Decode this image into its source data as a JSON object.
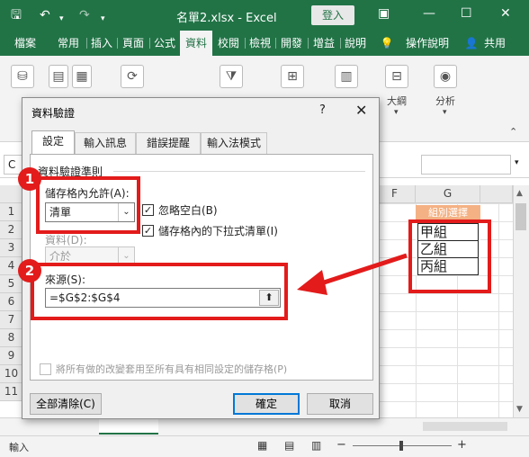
{
  "titlebar": {
    "file_title": "名單2.xlsx  -  Excel",
    "login_label": "登入",
    "minimize_glyph": "—",
    "maximize_glyph": "☐",
    "close_glyph": "✕"
  },
  "ribbon_tabs": [
    "檔案",
    "常用",
    "插入",
    "頁面",
    "公式",
    "資料",
    "校閱",
    "檢視",
    "開發",
    "增益",
    "說明"
  ],
  "ribbon_extra": {
    "tell_me": "操作說明",
    "share": "共用"
  },
  "ribbon_groups": {
    "outline": "大綱",
    "analysis": "分析"
  },
  "formula_bar": {
    "name_box": "C"
  },
  "sheet": {
    "columns": [
      "F",
      "G"
    ],
    "rows": [
      "1",
      "2",
      "3",
      "4",
      "5",
      "6",
      "7",
      "8",
      "9",
      "10",
      "11"
    ],
    "g_header_cell": "組別選擇",
    "g_cells": [
      "甲組",
      "乙組",
      "丙組"
    ]
  },
  "status": {
    "mode": "輸入"
  },
  "dialog": {
    "title": "資料驗證",
    "help_glyph": "?",
    "close_glyph": "✕",
    "tabs": [
      "設定",
      "輸入訊息",
      "錯誤提醒",
      "輸入法模式"
    ],
    "section_label": "資料驗證準則",
    "allow_label": "儲存格內允許(A):",
    "allow_value": "清單",
    "ignore_blank_label": "忽略空白(B)",
    "dropdown_label": "儲存格內的下拉式清單(I)",
    "data_label": "資料(D):",
    "data_value": "介於",
    "source_label": "來源(S):",
    "source_value": "=$G$2:$G$4",
    "apply_all_label": "將所有做的改變套用至所有具有相同設定的儲存格(P)",
    "clear_all_label": "全部清除(C)",
    "ok_label": "確定",
    "cancel_label": "取消"
  },
  "annotations": {
    "badge1": "1",
    "badge2": "2"
  },
  "colors": {
    "excel_green": "#217346",
    "annotation_red": "#e31b1b",
    "focus_blue": "#0078d7"
  }
}
